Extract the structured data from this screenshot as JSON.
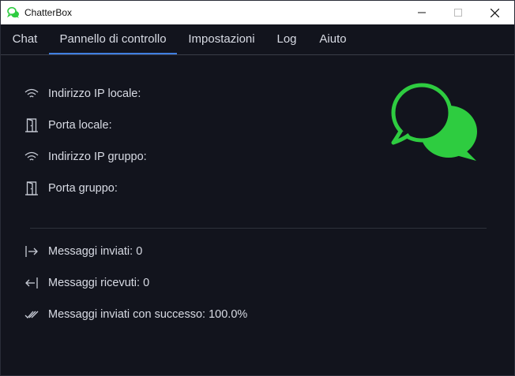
{
  "window": {
    "title": "ChatterBox"
  },
  "tabs": [
    "Chat",
    "Pannello di controllo",
    "Impostazioni",
    "Log",
    "Aiuto"
  ],
  "network": {
    "local_ip": {
      "label": "Indirizzo IP locale:",
      "value": ""
    },
    "local_port": {
      "label": "Porta locale:",
      "value": ""
    },
    "group_ip": {
      "label": "Indirizzo IP gruppo:",
      "value": ""
    },
    "group_port": {
      "label": "Porta gruppo:",
      "value": ""
    }
  },
  "stats": {
    "sent": "Messaggi inviati: 0",
    "received": "Messaggi ricevuti: 0",
    "success": "Messaggi inviati con successo: 100.0%"
  },
  "colors": {
    "accent": "#3f7fe0",
    "brand": "#2ecc40",
    "background": "#12141d"
  }
}
